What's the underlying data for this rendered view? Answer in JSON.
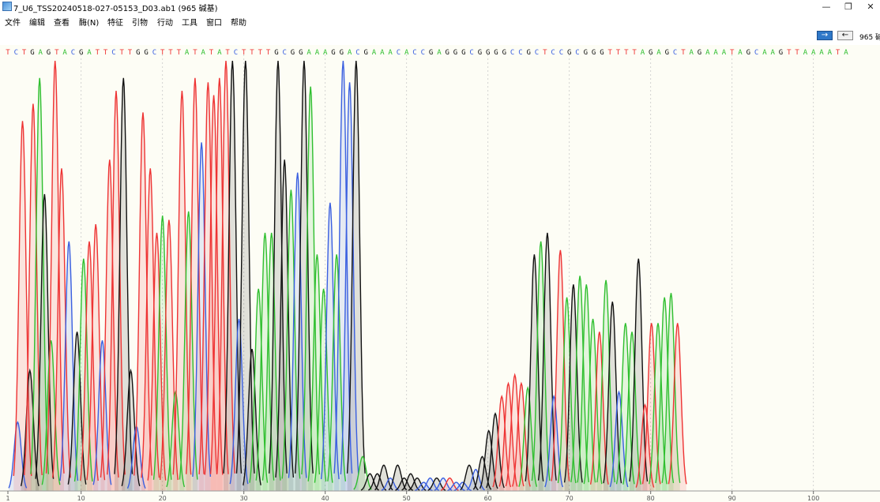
{
  "window": {
    "title": "7_U6_TSS20240518-027-05153_D03.ab1  (965 碱基)",
    "minimize_glyph": "—",
    "restore_glyph": "❐",
    "close_glyph": "✕"
  },
  "menu": [
    "文件",
    "编辑",
    "查看",
    "酶(N)",
    "特征",
    "引物",
    "行动",
    "工具",
    "窗口",
    "帮助"
  ],
  "toolbar": {
    "forward_glyph": "→",
    "back_glyph": "←",
    "base_count": "965 碱"
  },
  "colors": {
    "A": "#2fbf2f",
    "C": "#3a5fe0",
    "G": "#111111",
    "T": "#ee3333",
    "N": "#666666"
  },
  "chart_data": {
    "type": "chromatogram",
    "sequence": "TCTGAGTACGATTCTTGGCTTTATATATCTTTTGCGGAAAGGACGAAACACCGAGGGCGGGGCCGCTCCGCGGGTTTTAGAGCTAGAAATAGCAAGTTAAAATA",
    "tick_labels": [
      1,
      10,
      20,
      30,
      40,
      50,
      60,
      70,
      80,
      90,
      100
    ],
    "ylim": [
      0,
      100
    ],
    "peaks": [
      {
        "base": "C",
        "x": 2.2,
        "h": 16
      },
      {
        "base": "T",
        "x": 2.8,
        "h": 86
      },
      {
        "base": "G",
        "x": 3.7,
        "h": 28
      },
      {
        "base": "T",
        "x": 4.1,
        "h": 90
      },
      {
        "base": "A",
        "x": 4.9,
        "h": 96
      },
      {
        "base": "G",
        "x": 5.5,
        "h": 69
      },
      {
        "base": "A",
        "x": 6.3,
        "h": 35
      },
      {
        "base": "T",
        "x": 6.8,
        "h": 100
      },
      {
        "base": "T",
        "x": 7.6,
        "h": 75
      },
      {
        "base": "C",
        "x": 8.5,
        "h": 58
      },
      {
        "base": "G",
        "x": 9.5,
        "h": 37
      },
      {
        "base": "A",
        "x": 10.3,
        "h": 54
      },
      {
        "base": "T",
        "x": 11.0,
        "h": 58
      },
      {
        "base": "T",
        "x": 11.8,
        "h": 62
      },
      {
        "base": "C",
        "x": 12.6,
        "h": 35
      },
      {
        "base": "T",
        "x": 13.5,
        "h": 77
      },
      {
        "base": "T",
        "x": 14.3,
        "h": 93
      },
      {
        "base": "G",
        "x": 15.2,
        "h": 96
      },
      {
        "base": "G",
        "x": 16.1,
        "h": 28
      },
      {
        "base": "C",
        "x": 16.8,
        "h": 15
      },
      {
        "base": "T",
        "x": 17.6,
        "h": 88
      },
      {
        "base": "T",
        "x": 18.5,
        "h": 75
      },
      {
        "base": "T",
        "x": 19.3,
        "h": 60
      },
      {
        "base": "A",
        "x": 20.0,
        "h": 64
      },
      {
        "base": "T",
        "x": 20.8,
        "h": 63
      },
      {
        "base": "A",
        "x": 21.6,
        "h": 23
      },
      {
        "base": "T",
        "x": 22.4,
        "h": 93
      },
      {
        "base": "A",
        "x": 23.2,
        "h": 65
      },
      {
        "base": "T",
        "x": 24.0,
        "h": 96
      },
      {
        "base": "C",
        "x": 24.8,
        "h": 81
      },
      {
        "base": "T",
        "x": 25.6,
        "h": 95
      },
      {
        "base": "T",
        "x": 26.3,
        "h": 92
      },
      {
        "base": "T",
        "x": 27.0,
        "h": 96
      },
      {
        "base": "T",
        "x": 27.8,
        "h": 100
      },
      {
        "base": "G",
        "x": 28.6,
        "h": 100
      },
      {
        "base": "C",
        "x": 29.4,
        "h": 40
      },
      {
        "base": "G",
        "x": 30.2,
        "h": 100
      },
      {
        "base": "G",
        "x": 31.0,
        "h": 33
      },
      {
        "base": "A",
        "x": 31.8,
        "h": 47
      },
      {
        "base": "A",
        "x": 32.6,
        "h": 60
      },
      {
        "base": "A",
        "x": 33.4,
        "h": 60
      },
      {
        "base": "G",
        "x": 34.2,
        "h": 100
      },
      {
        "base": "G",
        "x": 35.0,
        "h": 77
      },
      {
        "base": "A",
        "x": 35.8,
        "h": 70
      },
      {
        "base": "C",
        "x": 36.6,
        "h": 74
      },
      {
        "base": "G",
        "x": 37.4,
        "h": 100
      },
      {
        "base": "A",
        "x": 38.2,
        "h": 94
      },
      {
        "base": "A",
        "x": 39.0,
        "h": 55
      },
      {
        "base": "A",
        "x": 39.8,
        "h": 47
      },
      {
        "base": "C",
        "x": 40.6,
        "h": 67
      },
      {
        "base": "A",
        "x": 41.4,
        "h": 55
      },
      {
        "base": "C",
        "x": 42.2,
        "h": 100
      },
      {
        "base": "C",
        "x": 43.0,
        "h": 95
      },
      {
        "base": "G",
        "x": 43.8,
        "h": 100
      },
      {
        "base": "A",
        "x": 44.6,
        "h": 8
      },
      {
        "base": "G",
        "x": 45.5,
        "h": 4
      },
      {
        "base": "G",
        "x": 46.4,
        "h": 4
      },
      {
        "base": "G",
        "x": 47.2,
        "h": 6
      },
      {
        "base": "C",
        "x": 48.0,
        "h": 3
      },
      {
        "base": "G",
        "x": 48.9,
        "h": 6
      },
      {
        "base": "G",
        "x": 49.7,
        "h": 3
      },
      {
        "base": "G",
        "x": 50.5,
        "h": 4
      },
      {
        "base": "G",
        "x": 51.3,
        "h": 3
      },
      {
        "base": "C",
        "x": 52.1,
        "h": 2
      },
      {
        "base": "C",
        "x": 52.9,
        "h": 3
      },
      {
        "base": "G",
        "x": 53.7,
        "h": 3
      },
      {
        "base": "C",
        "x": 54.5,
        "h": 3
      },
      {
        "base": "T",
        "x": 55.3,
        "h": 3
      },
      {
        "base": "C",
        "x": 56.1,
        "h": 2
      },
      {
        "base": "C",
        "x": 56.9,
        "h": 2
      },
      {
        "base": "G",
        "x": 57.7,
        "h": 6
      },
      {
        "base": "C",
        "x": 58.5,
        "h": 5
      },
      {
        "base": "G",
        "x": 59.3,
        "h": 8
      },
      {
        "base": "G",
        "x": 60.1,
        "h": 14
      },
      {
        "base": "G",
        "x": 60.9,
        "h": 18
      },
      {
        "base": "T",
        "x": 61.7,
        "h": 22
      },
      {
        "base": "T",
        "x": 62.5,
        "h": 25
      },
      {
        "base": "T",
        "x": 63.3,
        "h": 27
      },
      {
        "base": "T",
        "x": 64.1,
        "h": 25
      },
      {
        "base": "A",
        "x": 64.9,
        "h": 24
      },
      {
        "base": "G",
        "x": 65.7,
        "h": 55
      },
      {
        "base": "A",
        "x": 66.5,
        "h": 58
      },
      {
        "base": "G",
        "x": 67.3,
        "h": 60
      },
      {
        "base": "C",
        "x": 68.1,
        "h": 22
      },
      {
        "base": "T",
        "x": 68.9,
        "h": 56
      },
      {
        "base": "A",
        "x": 69.7,
        "h": 45
      },
      {
        "base": "G",
        "x": 70.5,
        "h": 48
      },
      {
        "base": "A",
        "x": 71.3,
        "h": 50
      },
      {
        "base": "A",
        "x": 72.1,
        "h": 48
      },
      {
        "base": "A",
        "x": 72.9,
        "h": 40
      },
      {
        "base": "T",
        "x": 73.7,
        "h": 37
      },
      {
        "base": "A",
        "x": 74.5,
        "h": 49
      },
      {
        "base": "G",
        "x": 75.3,
        "h": 44
      },
      {
        "base": "C",
        "x": 76.1,
        "h": 23
      },
      {
        "base": "A",
        "x": 76.9,
        "h": 39
      },
      {
        "base": "A",
        "x": 77.7,
        "h": 37
      },
      {
        "base": "G",
        "x": 78.5,
        "h": 54
      },
      {
        "base": "T",
        "x": 79.3,
        "h": 20
      },
      {
        "base": "T",
        "x": 80.1,
        "h": 39
      },
      {
        "base": "A",
        "x": 80.9,
        "h": 39
      },
      {
        "base": "A",
        "x": 81.7,
        "h": 45
      },
      {
        "base": "A",
        "x": 82.5,
        "h": 46
      },
      {
        "base": "T",
        "x": 83.3,
        "h": 39
      }
    ]
  }
}
